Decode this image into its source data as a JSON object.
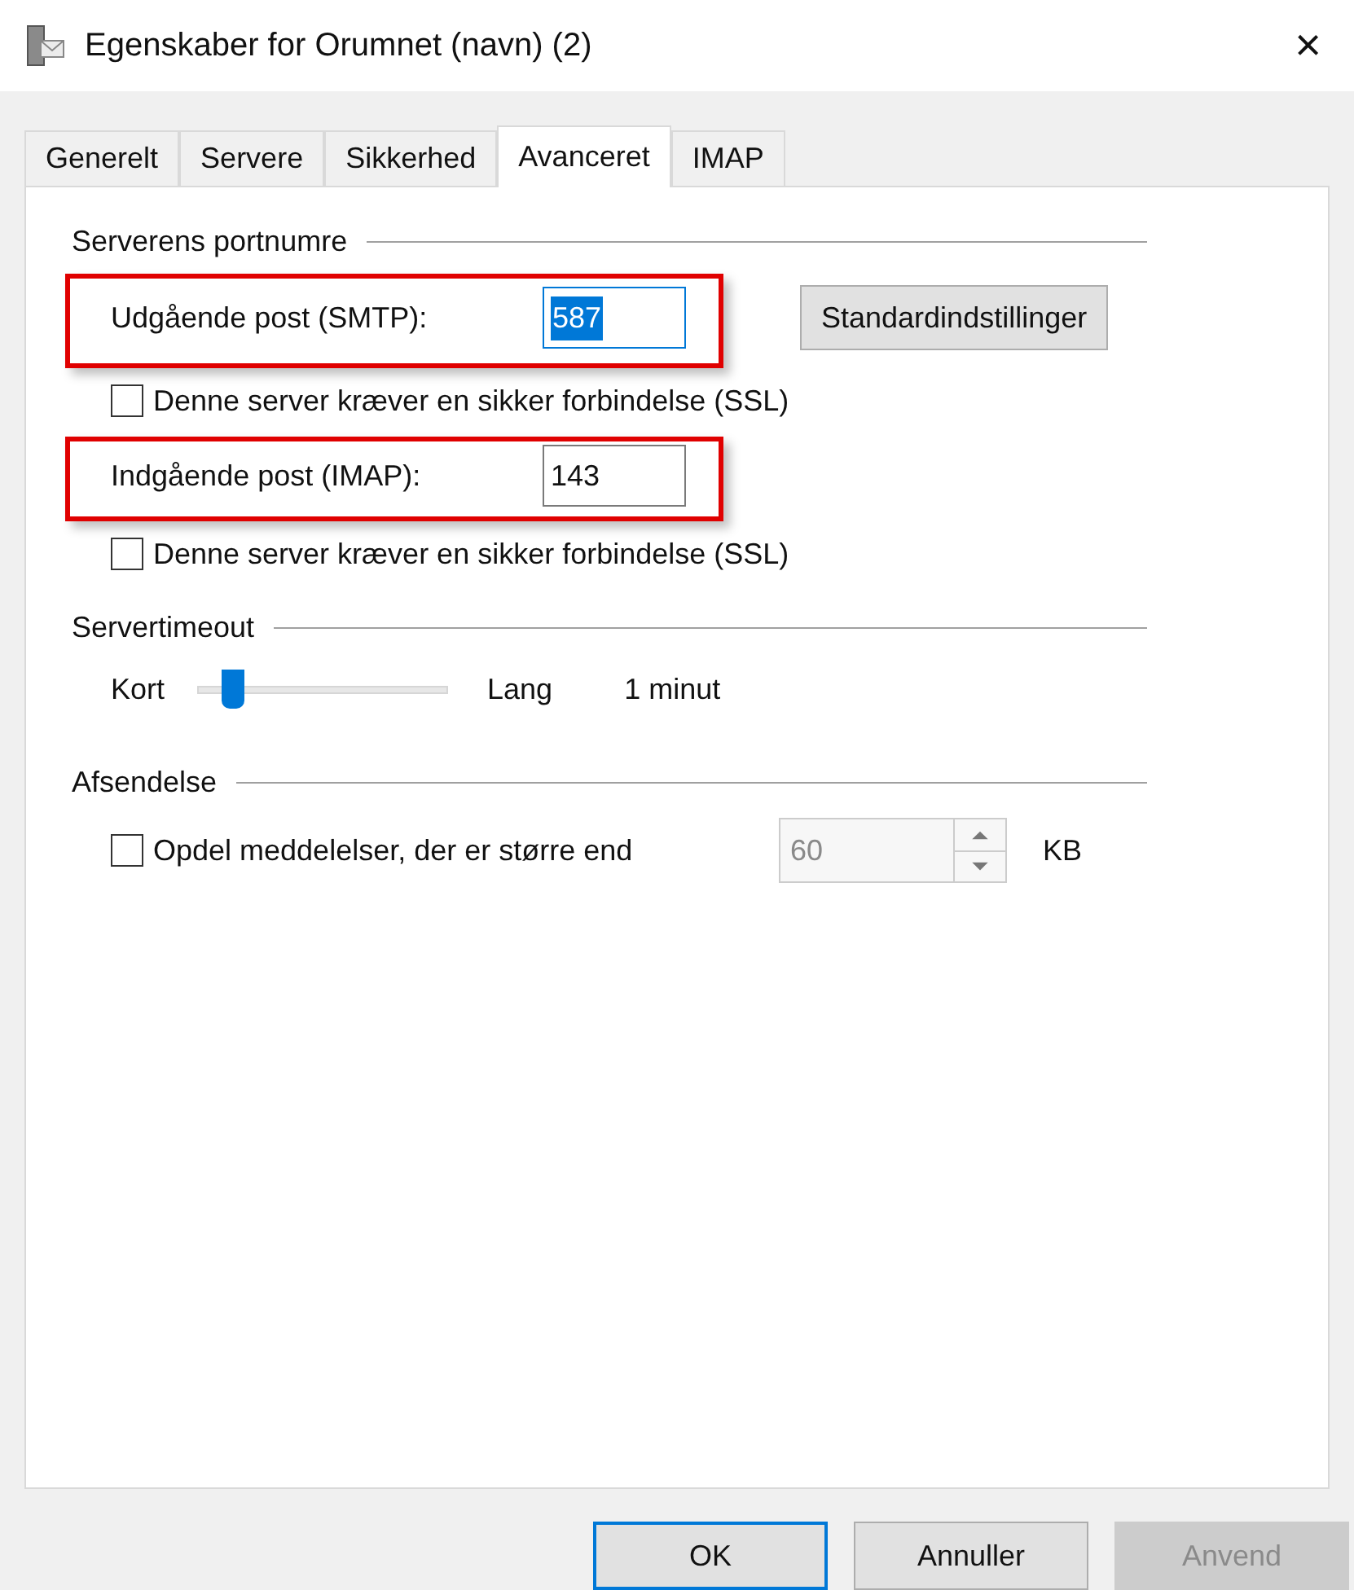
{
  "window": {
    "title": "Egenskaber for Orumnet (navn) (2)",
    "close": "×"
  },
  "tabs": [
    {
      "label": "Generelt",
      "selected": false
    },
    {
      "label": "Servere",
      "selected": false
    },
    {
      "label": "Sikkerhed",
      "selected": false
    },
    {
      "label": "Avanceret",
      "selected": true
    },
    {
      "label": "IMAP",
      "selected": false
    }
  ],
  "ports": {
    "title": "Serverens portnumre",
    "default_button": "Standardindstillinger",
    "rows": [
      {
        "label": "Udgående post (SMTP):",
        "value": "587",
        "focused": true,
        "highlighted": true,
        "ssl": {
          "label": "Denne server kræver en sikker forbindelse (SSL)",
          "checked": false
        }
      },
      {
        "label": "Indgående post (IMAP):",
        "value": "143",
        "focused": false,
        "highlighted": true,
        "ssl": {
          "label": "Denne server kræver en sikker forbindelse (SSL)",
          "checked": false
        }
      }
    ]
  },
  "timeout": {
    "title": "Servertimeout",
    "min_label": "Kort",
    "max_label": "Lang",
    "level": 0.14,
    "reading": "1 minut"
  },
  "sending": {
    "title": "Afsendelse",
    "split": {
      "label": "Opdel meddelelser, der er større end",
      "checked": false,
      "value": "60",
      "disabled": true,
      "unit": "KB"
    }
  },
  "buttons": [
    {
      "label": "OK",
      "default": true,
      "disabled": false
    },
    {
      "label": "Annuller",
      "default": false,
      "disabled": false
    },
    {
      "label": "Anvend",
      "default": false,
      "disabled": true
    }
  ]
}
